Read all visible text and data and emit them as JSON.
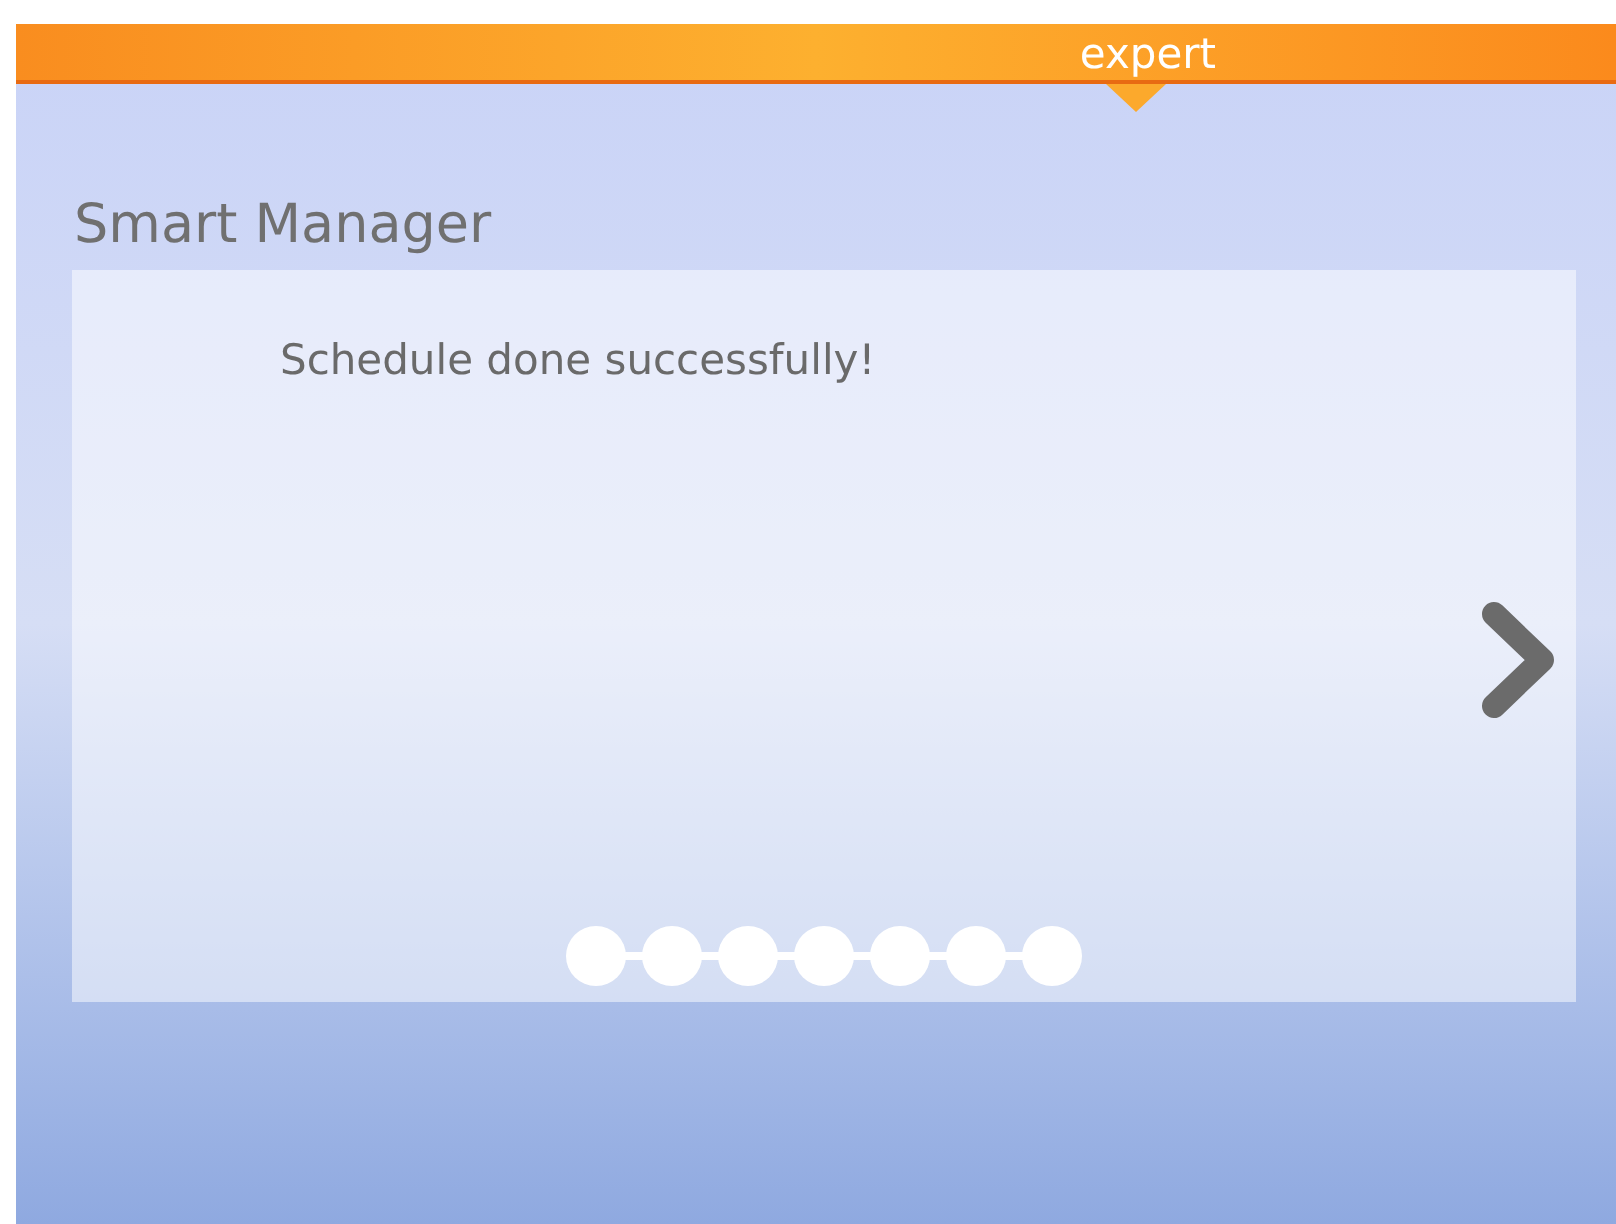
{
  "header": {
    "mode_label": "expert"
  },
  "title": "Smart Manager",
  "card": {
    "message": "Schedule done successfully!"
  }
}
